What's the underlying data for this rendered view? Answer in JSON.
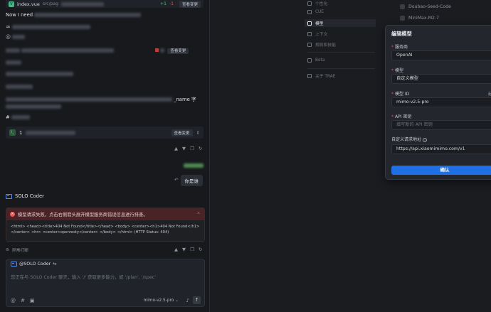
{
  "chat": {
    "file_chip": {
      "name": "index.vue",
      "path": "src/pag",
      "added": "+1",
      "removed": "-1",
      "view_changes": "查看变更"
    },
    "intro_text": "Now I need",
    "second_view_changes": "查看变更",
    "name_suffix": "_name 字",
    "hash_char": "#",
    "tool_row": {
      "count": "1",
      "view_changes": "查看变更"
    },
    "user_message": "你是谁",
    "coder": {
      "name": "SOLO Coder"
    },
    "error": {
      "title": "模型请求失败，点击右侧箭头展开模型服务商错误信息进行排查。",
      "body": "<html> <head><title>404 Not Found</title></head> <body> <center><h1>404 Not Found</h1></center> <hr> <center>openresty</center> </body> </html> (HTTP Status: 404)"
    },
    "abort_label": "异常打断",
    "input": {
      "mention": "@SOLO Coder",
      "placeholder": "您正在与 SOLO Coder 聊天，输入 '/' 获取更多能力，如 '/plan', '/spec'",
      "model": "mimo-v2.5-pro"
    }
  },
  "settings_nav": {
    "items": [
      "个性化",
      "CUE",
      "模型",
      "上下文",
      "规则和技能",
      "Beta",
      "关于 TRAE"
    ],
    "active_index": 2
  },
  "model_list": [
    "Doubao-Seed-Code",
    "MiniMax-M2.7"
  ],
  "dialog": {
    "title": "编辑模型",
    "provider_label": "服务商",
    "provider_value": "OpenAI",
    "model_label": "模型",
    "model_value": "自定义模型",
    "model_id_label": "模型 ID",
    "model_id_value": "mimo-v2.5-pro",
    "api_key_label": "API 密钥",
    "api_key_placeholder": "填写新的 API 密钥",
    "custom_url_label": "自定义请求地址",
    "custom_url_value": "https://api.xiaomimimo.com/v1",
    "side_hint": "起",
    "confirm": "确认"
  },
  "colors": {
    "accent": "#1f6fe5",
    "error_bg": "#4a2327",
    "panel_bg": "#17191d"
  }
}
